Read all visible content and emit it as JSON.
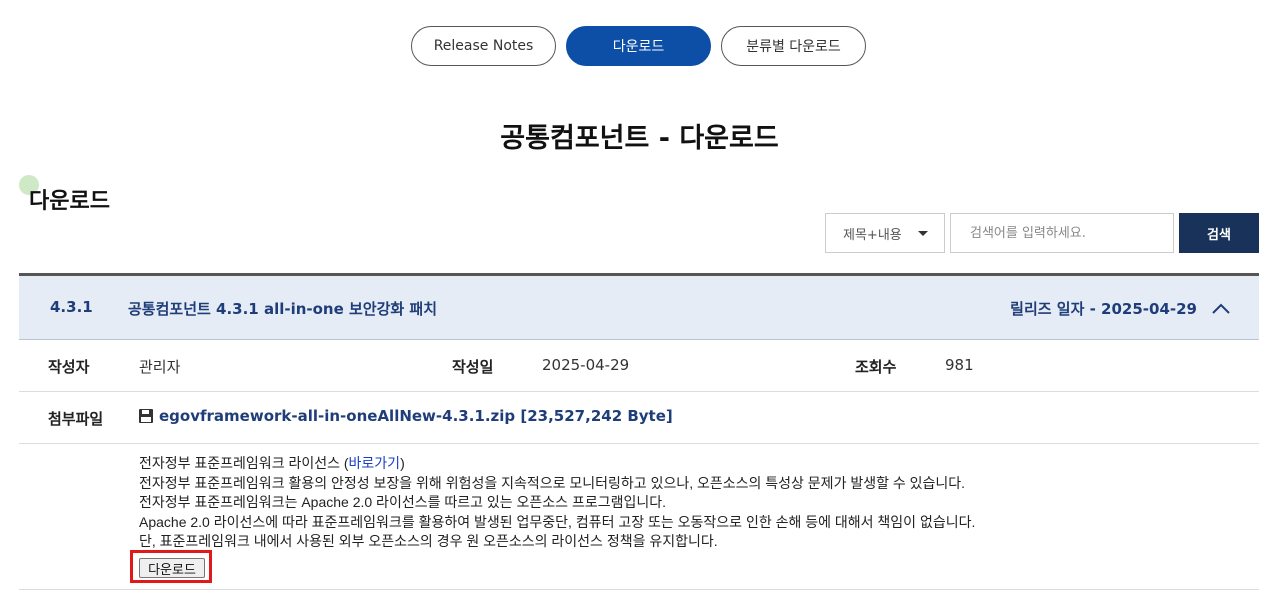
{
  "tabs": [
    {
      "label": "Release Notes",
      "active": false
    },
    {
      "label": "다운로드",
      "active": true
    },
    {
      "label": "분류별 다운로드",
      "active": false
    }
  ],
  "page_title": "공통컴포넌트 - 다운로드",
  "section_title": "다운로드",
  "search": {
    "select_value": "제목+내용",
    "placeholder": "검색어를 입력하세요.",
    "button_label": "검색"
  },
  "post": {
    "version": "4.3.1",
    "subject": "공통컴포넌트 4.3.1 all-in-one 보안강화 패치",
    "release_label": "릴리즈 일자 - 2025-04-29",
    "author_label": "작성자",
    "author": "관리자",
    "date_label": "작성일",
    "date": "2025-04-29",
    "views_label": "조회수",
    "views": "981",
    "attach_label": "첨부파일",
    "attachment": "egovframework-all-in-oneAllNew-4.3.1.zip [23,527,242 Byte]",
    "license_line_prefix": "전자정부 표준프레임워크 라이선스 (",
    "license_link": "바로가기",
    "license_line_suffix": ")",
    "lines": [
      "전자정부 표준프레임워크 활용의 안정성 보장을 위해 위험성을 지속적으로 모니터링하고 있으나, 오픈소스의 특성상 문제가 발생할 수 있습니다.",
      "전자정부 표준프레임워크는 Apache 2.0 라이선스를 따르고 있는 오픈소스 프로그램입니다.",
      "Apache 2.0 라이선스에 따라 표준프레임워크를 활용하여 발생된 업무중단, 컴퓨터 고장 또는 오동작으로 인한 손해 등에 대해서 책임이 없습니다.",
      "단, 표준프레임워크 내에서 사용된 외부 오픈소스의 경우 원 오픈소스의 라이선스 정책을 유지합니다."
    ],
    "download_label": "다운로드"
  },
  "colors": {
    "accent": "#0d4ea6",
    "search_button": "#18325a",
    "header_bg": "#e6ecf6",
    "highlight": "#e01a1a"
  }
}
